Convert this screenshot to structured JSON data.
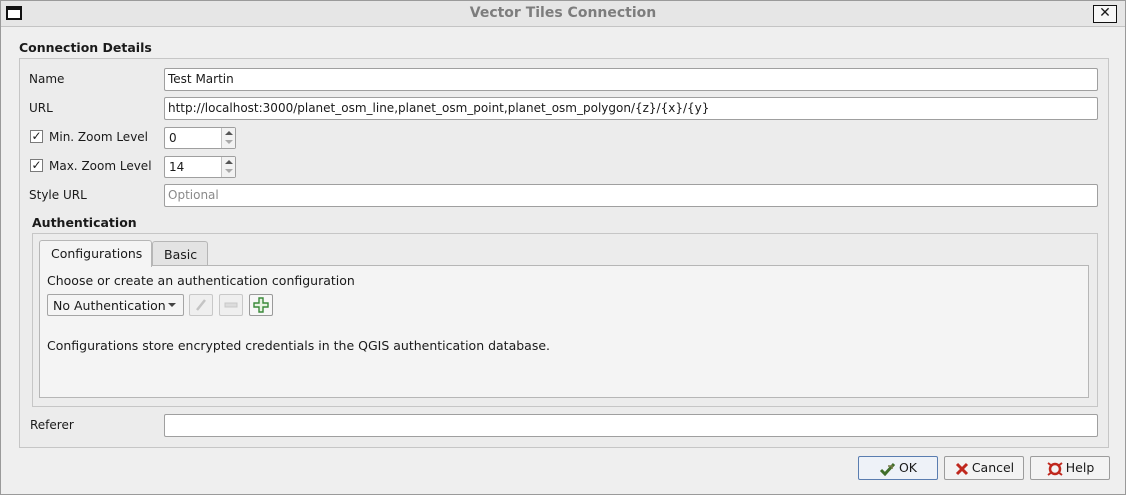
{
  "window": {
    "title": "Vector Tiles Connection",
    "close_label": "✕"
  },
  "connection": {
    "group_title": "Connection Details",
    "name_label": "Name",
    "name_value": "Test Martin",
    "url_label": "URL",
    "url_value": "http://localhost:3000/planet_osm_line,planet_osm_point,planet_osm_polygon/{z}/{x}/{y}",
    "min_zoom": {
      "label": "Min. Zoom Level",
      "checked": true,
      "value": "0"
    },
    "max_zoom": {
      "label": "Max. Zoom Level",
      "checked": true,
      "value": "14"
    },
    "style_url_label": "Style URL",
    "style_url_placeholder": "Optional",
    "referer_label": "Referer",
    "referer_value": ""
  },
  "authentication": {
    "group_title": "Authentication",
    "tabs": [
      {
        "label": "Configurations",
        "active": true
      },
      {
        "label": "Basic",
        "active": false
      }
    ],
    "prompt": "Choose or create an authentication configuration",
    "selected_config": "No Authentication",
    "info_text": "Configurations store encrypted credentials in the QGIS authentication database."
  },
  "buttons": {
    "ok": "OK",
    "cancel": "Cancel",
    "help": "Help"
  },
  "icons": {
    "ok": "ok-check-icon",
    "cancel": "cancel-x-icon",
    "help": "help-icon",
    "edit": "pencil-icon",
    "remove": "remove-icon",
    "add": "add-plus-icon"
  },
  "colors": {
    "add_icon": "#3a8a3a",
    "cancel_icon": "#c0281e",
    "ok_icon": "#3f6e2a"
  }
}
